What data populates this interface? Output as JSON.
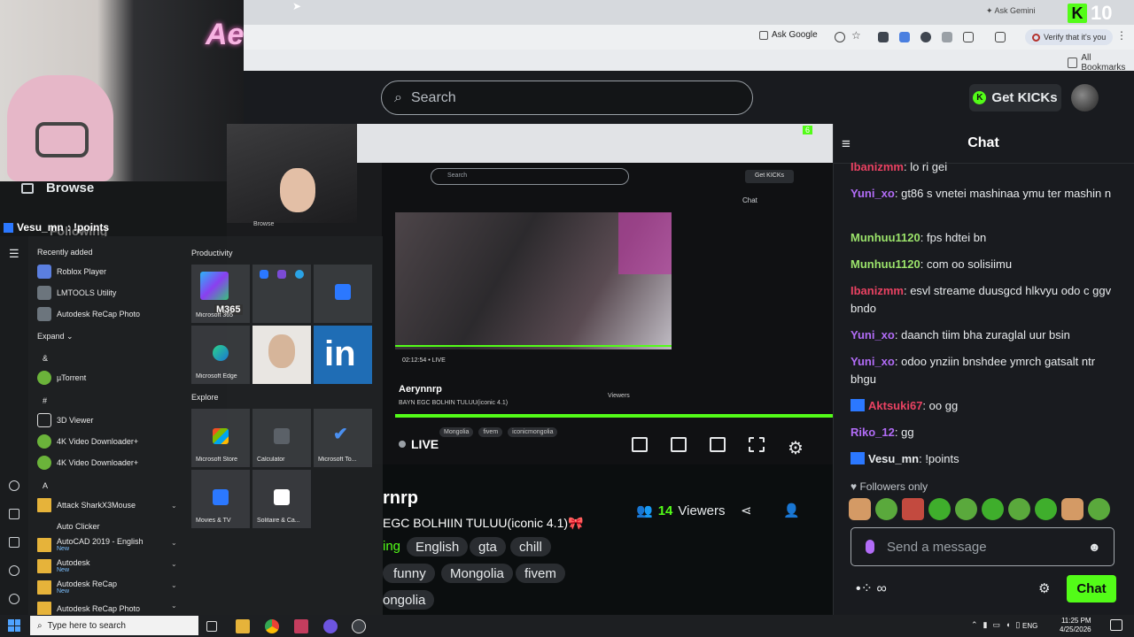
{
  "browser": {
    "ask_gemini": "Ask Gemini",
    "ask_google": "Ask Google",
    "verify": "Verify that it's you",
    "all_bookmarks": "All Bookmarks",
    "kicks_balance": "10"
  },
  "header": {
    "search_placeholder": "Search",
    "get_kicks": "Get KICKs"
  },
  "sidebar": {
    "browse": "Browse",
    "following": "Following",
    "top_chat_user": "Vesu_mn",
    "top_chat_text": ": !points"
  },
  "webcam": {
    "sign": "Ae"
  },
  "player": {
    "live_label": "LIVE",
    "mini_time": "02:12:54",
    "mini_live": "LIVE",
    "mini_channel": "Aerynnrp",
    "mini_title": "BAYN EGC BOLHIN TULUU(iconic 4.1)",
    "mini_viewers": "Viewers",
    "mini_chat": "Chat",
    "mini_search": "Search",
    "mini_getkicks": "Get KICKs",
    "mini_browse": "Browse",
    "mini_tags": [
      "Mongolia",
      "fivem",
      "iconicmongolia"
    ],
    "mini_balance": "6"
  },
  "channel": {
    "name": "rnrp",
    "title": "EGC BOLHIIN TULUU(iconic 4.1)",
    "title_emoji": "🎀",
    "viewer_count": "14",
    "viewers_label": "Viewers",
    "category_fragment": "ing",
    "tags": [
      "English",
      "gta",
      "chill",
      "funny",
      "Mongolia",
      "fivem",
      "ongolia"
    ]
  },
  "chat": {
    "title": "Chat",
    "messages": [
      {
        "user": "Ibanizmm",
        "color": "#e94262",
        "text": ": lo ri gei",
        "badge": false
      },
      {
        "user": "Yuni_xo",
        "color": "#b26cf7",
        "text": ": gt86 s vnetei mashinaa ymu ter mashin n",
        "badge": false
      },
      {
        "user": "Munhuu1120",
        "color": "#9be36b",
        "text": ": fps hdtei bn",
        "badge": false
      },
      {
        "user": "Munhuu1120",
        "color": "#9be36b",
        "text": ": com oo solisiimu",
        "badge": false
      },
      {
        "user": "Ibanizmm",
        "color": "#e94262",
        "text": ": esvl streame duusgcd hlkvyu odo c ggv bndo",
        "badge": false
      },
      {
        "user": "Yuni_xo",
        "color": "#b26cf7",
        "text": ": daanch tiim bha zuraglal uur bsin",
        "badge": false
      },
      {
        "user": "Yuni_xo",
        "color": "#b26cf7",
        "text": ": odoo ynziin bnshdee ymrch gatsalt ntr bhgu",
        "badge": false
      },
      {
        "user": "Aktsuki67",
        "color": "#e94262",
        "text": ": oo gg",
        "badge": true
      },
      {
        "user": "Riko_12",
        "color": "#b26cf7",
        "text": ": gg",
        "badge": false
      },
      {
        "user": "Vesu_mn",
        "color": "#e8ebed",
        "text": ": !points",
        "badge": true
      }
    ],
    "followers_only": "Followers only",
    "input_placeholder": "Send a message",
    "send_label": "Chat"
  },
  "start_menu": {
    "recently_added": "Recently added",
    "recent": [
      "Roblox Player",
      "LMTOOLS Utility",
      "Autodesk ReCap Photo"
    ],
    "expand": "Expand",
    "letters": [
      "&",
      "#",
      "A"
    ],
    "apps": [
      {
        "name": "µTorrent",
        "sub": ""
      },
      {
        "name": "3D Viewer",
        "sub": ""
      },
      {
        "name": "4K Video Downloader+",
        "sub": ""
      },
      {
        "name": "4K Video Downloader+",
        "sub": ""
      },
      {
        "name": "Attack SharkX3Mouse",
        "sub": ""
      },
      {
        "name": "Auto Clicker",
        "sub": ""
      },
      {
        "name": "AutoCAD 2019 - English",
        "sub": "New"
      },
      {
        "name": "Autodesk",
        "sub": "New"
      },
      {
        "name": "Autodesk ReCap",
        "sub": "New"
      },
      {
        "name": "Autodesk ReCap Photo",
        "sub": ""
      }
    ],
    "productivity": "Productivity",
    "explore": "Explore",
    "tiles": [
      "Microsoft 365",
      "",
      "",
      "Microsoft Edge",
      "",
      "",
      "Microsoft Store",
      "Calculator",
      "Microsoft To...",
      "Movies & TV",
      "Solitaire & Ca..."
    ],
    "m365_badge": "M365"
  },
  "taskbar": {
    "search_placeholder": "Type here to search",
    "time": "11:25 PM",
    "date": "4/25/2026",
    "lang": "ENG"
  }
}
